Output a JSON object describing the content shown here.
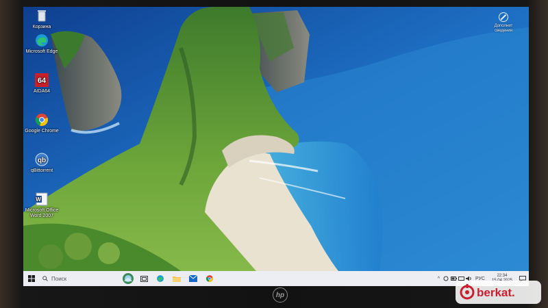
{
  "desktop": {
    "icons": [
      {
        "label": "Корзина",
        "icon": "recycle-bin-icon"
      },
      {
        "label": "Microsoft Edge",
        "icon": "edge-icon"
      },
      {
        "label": "AIDA64",
        "icon": "aida64-icon"
      },
      {
        "label": "Google Chrome",
        "icon": "chrome-icon"
      },
      {
        "label": "qBittorrent",
        "icon": "qbittorrent-icon"
      },
      {
        "label": "Microsoft Office Word 2007",
        "icon": "word-icon"
      }
    ],
    "activation_notice": "Дополнит сведения"
  },
  "taskbar": {
    "search_placeholder": "Поиск",
    "pinned": [
      "task-view-icon",
      "edge-icon",
      "file-explorer-icon",
      "mail-icon",
      "chrome-icon"
    ],
    "tray": {
      "language": "РУС",
      "time": "22:34",
      "date": "15.04.2025"
    }
  },
  "bezel": {
    "logo": "hp",
    "watermark": "berkat."
  },
  "colors": {
    "taskbar_bg": "#eceef3",
    "sea": "#1b6fb8",
    "cliff_green": "#5f9a35",
    "sand": "#e9e2d0"
  }
}
